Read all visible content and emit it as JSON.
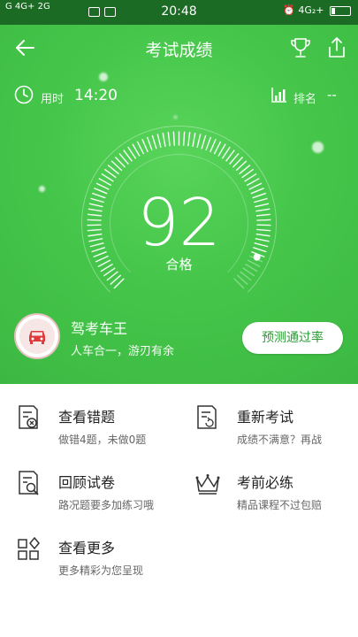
{
  "status_bar": {
    "left": "G 4G+ 2G",
    "time": "20:48",
    "right": "4G₂+"
  },
  "nav": {
    "title": "考试成绩",
    "back_icon": "arrow-left-icon",
    "trophy_icon": "trophy-icon",
    "share_icon": "share-icon"
  },
  "info": {
    "used_label": "用时",
    "used_value": "14:20",
    "rank_label": "排名",
    "rank_value": "--"
  },
  "result": {
    "score": "92",
    "status": "合格",
    "score_percent": 92
  },
  "brand": {
    "name": "驾考车王",
    "slogan": "人车合一，游刃有余",
    "predict_label": "预测通过率"
  },
  "menu": {
    "items": [
      {
        "title": "查看错题",
        "subtitle": "做错4题，未做0题",
        "icon": "wrong-questions-icon"
      },
      {
        "title": "重新考试",
        "subtitle": "成绩不满意？再战",
        "icon": "retake-exam-icon"
      },
      {
        "title": "回顾试卷",
        "subtitle": "路况题要多加练习哦",
        "icon": "review-paper-icon"
      },
      {
        "title": "考前必练",
        "subtitle": "精品课程不过包赔",
        "icon": "crown-icon"
      },
      {
        "title": "查看更多",
        "subtitle": "更多精彩为您呈现",
        "icon": "more-grid-icon"
      }
    ]
  },
  "colors": {
    "green": "#45c64a",
    "status_bar": "#1c6b25",
    "button_text": "#2a9c33"
  }
}
